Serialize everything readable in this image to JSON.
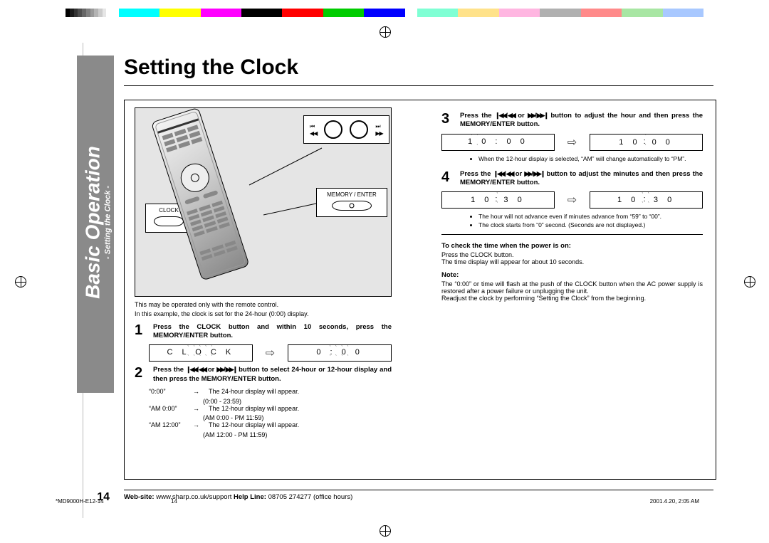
{
  "page": {
    "number": "14",
    "title": "Setting the Clock",
    "tab_main": "Basic Operation",
    "tab_sub": "- Setting the Clock -"
  },
  "callouts": {
    "clock": "CLOCK",
    "memory": "MEMORY / ENTER"
  },
  "column_left": {
    "caption1": "This may be operated only with the remote control.",
    "caption2": "In this example, the clock is set for the 24-hour (0:00) display.",
    "step1": "Press the CLOCK button and within 10 seconds, press the MEMORY/ENTER button.",
    "lcd1a": "C L O C K",
    "lcd1b": "0 : 0 0",
    "step2_a": "Press the ",
    "step2_b": " or ",
    "step2_c": " button to select 24-hour or 12-hour display and then press the MEMORY/ENTER button.",
    "def": [
      {
        "a": "“0:00”",
        "arw": "→",
        "b": "The 24-hour display will appear.",
        "sub": "(0:00 - 23:59)"
      },
      {
        "a": "“AM 0:00”",
        "arw": "→",
        "b": "The 12-hour display will appear.",
        "sub": "(AM 0:00 - PM 11:59)"
      },
      {
        "a": "“AM 12:00”",
        "arw": "→",
        "b": "The 12-hour display will appear.",
        "sub": "(AM 12:00 - PM 11:59)"
      }
    ]
  },
  "column_right": {
    "step3_a": "Press the ",
    "step3_b": " or ",
    "step3_c": " button to adjust the hour and then press the MEMORY/ENTER button.",
    "lcd3a": "1 0 : 0 0",
    "lcd3b": "1 0 : 0 0",
    "bul3": "When the 12-hour display is selected, “AM” will change automatically to “PM”.",
    "step4_a": "Press the ",
    "step4_b": " or ",
    "step4_c": " button to adjust the minutes and then press the MEMORY/ENTER button.",
    "lcd4a": "1 0 : 3 0",
    "lcd4b": "1 0 : 3 0",
    "bul4a": "The hour will not advance even if minutes advance from “59” to “00”.",
    "bul4b": "The clock starts from “0” second. (Seconds are not displayed.)",
    "check_h": "To check the time when the power is on:",
    "check1": "Press the CLOCK button.",
    "check2": "The time display will appear for about 10 seconds.",
    "note_h": "Note:",
    "note1": "The “0:00” or time will flash at the push of the CLOCK button when the AC power supply is restored after a power failure or unplugging the unit.",
    "note2": "Readjust the clock by performing “Setting the Clock” from the beginning."
  },
  "footer": {
    "web_l": "Web-site:",
    "web_v": " www.sharp.co.uk/support   ",
    "help_l": "Help Line:",
    "help_v": " 08705 274277 (office hours)"
  },
  "meta": {
    "file": "*MD9000H-E12-14",
    "pg": "14",
    "date": "2001.4.20, 2:05 AM"
  },
  "icons": {
    "rew": "❙◀◀",
    "rew2": "◀◀",
    "ffw": "▶▶",
    "ffw2": "▶▶❙"
  }
}
